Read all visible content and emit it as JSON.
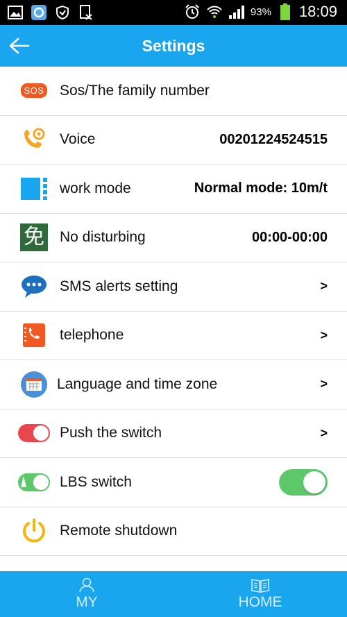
{
  "status_bar": {
    "battery": "93%",
    "time": "18:09"
  },
  "header": {
    "title": "Settings"
  },
  "settings": {
    "items": [
      {
        "label": "Sos/The family number",
        "value": "",
        "icon_text": "SOS"
      },
      {
        "label": "Voice",
        "value": "00201224524515"
      },
      {
        "label": "work mode",
        "value": "Normal mode: 10m/t"
      },
      {
        "label": "No disturbing",
        "value": "00:00-00:00",
        "icon_text": "免"
      },
      {
        "label": "SMS alerts setting",
        "arrow": ">"
      },
      {
        "label": "telephone",
        "arrow": ">"
      },
      {
        "label": "Language and time zone",
        "arrow": ">"
      },
      {
        "label": "Push the switch",
        "arrow": ">"
      },
      {
        "label": "LBS switch",
        "toggle_on": true
      },
      {
        "label": "Remote shutdown"
      }
    ]
  },
  "bottom_nav": {
    "my_label": "MY",
    "home_label": "HOME"
  },
  "colors": {
    "accent": "#1aa6ee",
    "toggle_on": "#5dc86a",
    "sos": "#f05a22",
    "push_toggle": "#e8474e"
  }
}
